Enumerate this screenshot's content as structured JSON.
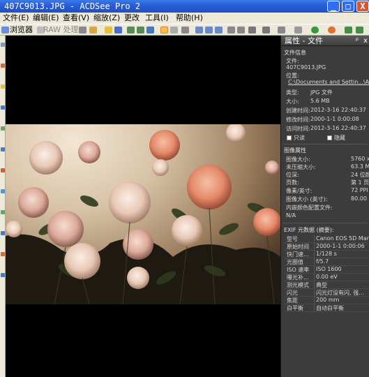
{
  "window": {
    "title": "407C9013.JPG - ACDSee Pro 2",
    "minimize": "_",
    "maximize": "□",
    "close": "X"
  },
  "menu": [
    "文件(E)",
    "编辑(E)",
    "查看(V)",
    "缩放(Z)",
    "更改",
    "工具(I)",
    "帮助(H)"
  ],
  "toolbar": {
    "browser": "浏览器",
    "raw": "RAW 处理"
  },
  "panel": {
    "title": "属性 - 文件",
    "pin": "ᵖ",
    "close": "x",
    "file_info": {
      "section": "文件信息",
      "file_label": "文件:",
      "file_name": "407C9013.JPG",
      "location_label": "位置:",
      "location": "C:\\Documents and Settin...\\Al\\",
      "type_label": "类型:",
      "type": "JPG 文件",
      "size_label": "大小:",
      "size": "5.6 MB",
      "created_label": "创建时间:",
      "created": "2012-3-16 22:40:37",
      "modified_label": "修改时间:",
      "modified": "2000-1-1 0:00:08",
      "accessed_label": "访问时间:",
      "accessed": "2012-3-16 22:40:37",
      "readonly": "只读",
      "hidden": "隐藏"
    },
    "image_attr": {
      "section": "图像属性",
      "image_size_label": "图像大小:",
      "image_size": "5760 x",
      "uncompressed_label": "未压缩大小:",
      "uncompressed": "63.3 M",
      "bitdepth_label": "位深:",
      "bitdepth": "24 位颜",
      "pages_label": "页数:",
      "pages": "第 1 页",
      "ppi_label": "像素/英寸:",
      "ppi": "72 PPI",
      "print_size_label": "图像大小 (英寸):",
      "print_size": "80.00",
      "profile_label": "内嵌颜色配置文件:",
      "profile": "N/A"
    },
    "exif": {
      "section": "EXIF 元数据 (摘要):",
      "rows": [
        {
          "k": "型号",
          "v": "Canon EOS 5D Mar..."
        },
        {
          "k": "原始时间",
          "v": "2000-1-1 0:00:06"
        },
        {
          "k": "快门速...",
          "v": "1/128 s"
        },
        {
          "k": "光圈值",
          "v": "f/5.7"
        },
        {
          "k": "ISO 速率",
          "v": "ISO 1600"
        },
        {
          "k": "曝光补...",
          "v": "0.00 eV"
        },
        {
          "k": "测光模式",
          "v": "典型"
        },
        {
          "k": "闪光",
          "v": "闪光灯没有闪, 强..."
        },
        {
          "k": "焦距",
          "v": "200 mm"
        },
        {
          "k": "白平衡",
          "v": "自动白平衡"
        }
      ]
    }
  }
}
